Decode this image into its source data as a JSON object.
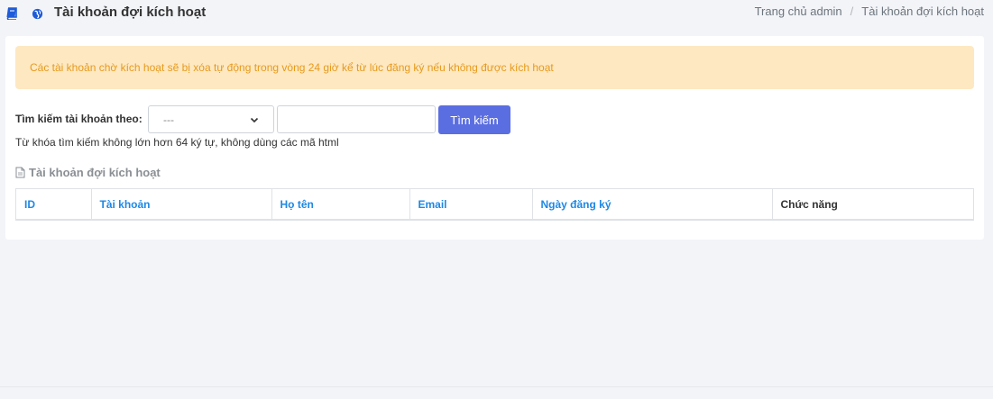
{
  "header": {
    "title": "Tài khoản đợi kích hoạt",
    "breadcrumb": {
      "home": "Trang chủ admin",
      "separator": "/",
      "current": "Tài khoản đợi kích hoạt"
    }
  },
  "alert": {
    "text": "Các tài khoản chờ kích hoạt sẽ bị xóa tự động trong vòng 24 giờ kể từ lúc đăng ký nếu không được kích hoạt"
  },
  "search": {
    "label": "Tìm kiếm tài khoản theo:",
    "select_value": "---",
    "input_value": "",
    "button_label": "Tìm kiếm",
    "hint": "Từ khóa tìm kiếm không lớn hơn 64 ký tự, không dùng các mã html"
  },
  "section": {
    "title": "Tài khoản đợi kích hoạt"
  },
  "table": {
    "columns": [
      "ID",
      "Tài khoản",
      "Họ tên",
      "Email",
      "Ngày đăng ký",
      "Chức năng"
    ]
  },
  "colors": {
    "primary": "#5b6ee1",
    "link": "#1e88e5",
    "alert_bg": "#fde8c2",
    "alert_text": "#e79a1c"
  }
}
